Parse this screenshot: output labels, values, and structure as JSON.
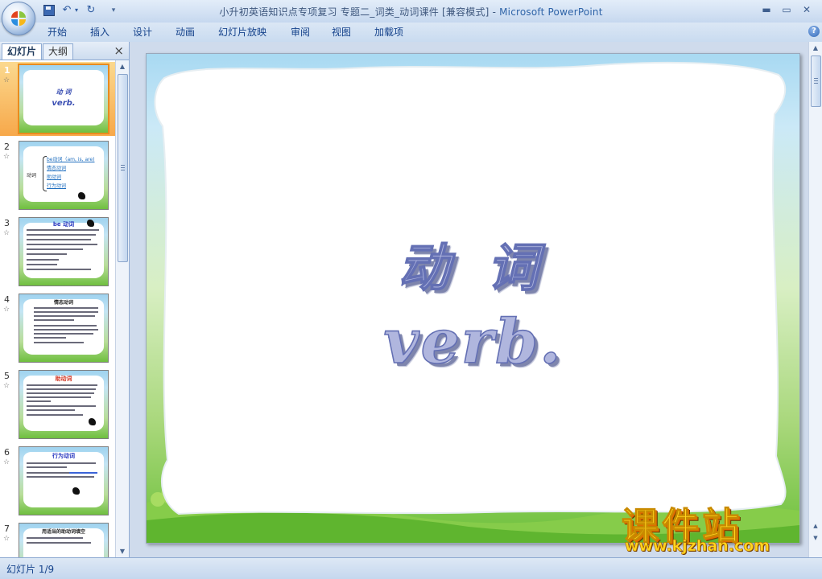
{
  "window": {
    "title_doc": "小升初英语知识点专项复习 专题二_词类_动词课件 [兼容模式]",
    "title_sep": " - ",
    "title_app": "Microsoft PowerPoint"
  },
  "quick_access": {
    "save": "save-icon",
    "undo": "undo-icon",
    "redo": "redo-icon"
  },
  "ribbon": {
    "tabs": [
      "开始",
      "插入",
      "设计",
      "动画",
      "幻灯片放映",
      "审阅",
      "视图",
      "加载项"
    ]
  },
  "panel": {
    "tab_slides": "幻灯片",
    "tab_outline": "大纲",
    "close": "×"
  },
  "thumbnails": [
    {
      "num": "1",
      "title_cn": "动 词",
      "title_en": "verb."
    },
    {
      "num": "2",
      "label": "动词",
      "items": [
        "be动词（am, is, are)",
        "情态动词",
        "助动词",
        "行为动词"
      ]
    },
    {
      "num": "3",
      "heading": "be 动词"
    },
    {
      "num": "4",
      "heading": "情态动词"
    },
    {
      "num": "5",
      "heading": "助动词"
    },
    {
      "num": "6",
      "heading": "行为动词"
    },
    {
      "num": "7",
      "heading": "用适当的助动词填空"
    }
  ],
  "slide": {
    "title_cn": "动 词",
    "title_en": "verb."
  },
  "watermark": {
    "brand": "课件站",
    "url": "www.kjzhan.com"
  },
  "status": {
    "slide_info": "幻灯片 1/9"
  },
  "colors": {
    "selection": "#f7a84a",
    "ribbon_text": "#15428b",
    "title_fill": "#b0b6de",
    "title_stroke": "#6470b4"
  }
}
